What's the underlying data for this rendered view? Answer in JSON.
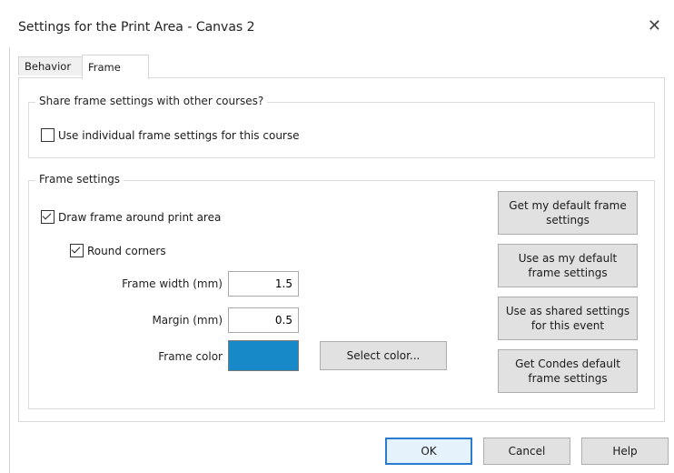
{
  "window": {
    "title": "Settings for the Print Area - Canvas 2",
    "close_icon": "close-icon"
  },
  "tabs": [
    {
      "label": "Behavior",
      "active": false
    },
    {
      "label": "Frame",
      "active": true
    }
  ],
  "share_group": {
    "label": "Share frame settings with other courses?",
    "checkbox_label": "Use individual frame settings for this course",
    "checked": false
  },
  "frame_group": {
    "label": "Frame settings",
    "draw_frame": {
      "label": "Draw frame around print area",
      "checked": true
    },
    "round_corners": {
      "label": "Round corners",
      "checked": true
    },
    "frame_width": {
      "label": "Frame width (mm)",
      "value": "1.5"
    },
    "margin": {
      "label": "Margin (mm)",
      "value": "0.5"
    },
    "frame_color": {
      "label": "Frame color",
      "color": "#1789c9"
    },
    "select_color_button": "Select color...",
    "side_buttons": {
      "get_default": "Get my default frame settings",
      "use_as_default": "Use as my default frame settings",
      "use_as_shared": "Use as shared settings for this event",
      "get_condes": "Get Condes default frame settings"
    }
  },
  "footer": {
    "ok": "OK",
    "cancel": "Cancel",
    "help": "Help"
  }
}
